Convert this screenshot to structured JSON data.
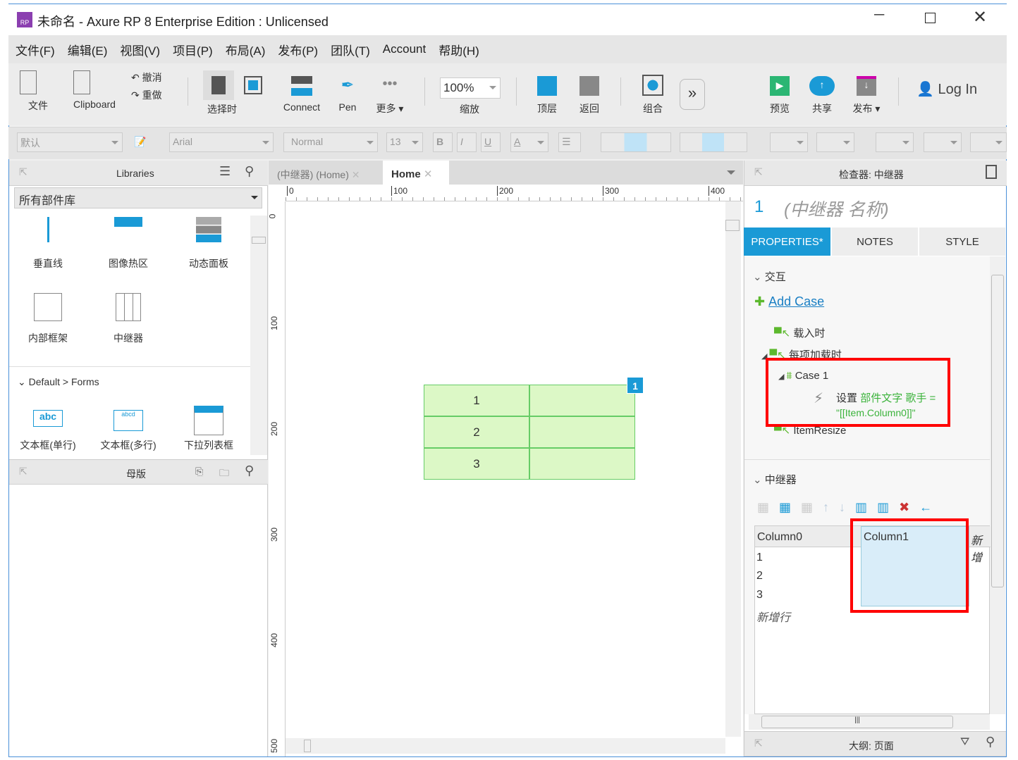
{
  "title": "未命名 - Axure RP 8 Enterprise Edition : Unlicensed",
  "app_icon": "RP",
  "menu": [
    "文件(F)",
    "编辑(E)",
    "视图(V)",
    "项目(P)",
    "布局(A)",
    "发布(P)",
    "团队(T)",
    "Account",
    "帮助(H)"
  ],
  "toolbar": {
    "file": "文件",
    "clipboard": "Clipboard",
    "undo": "撤消",
    "redo": "重做",
    "select": "选择时",
    "connect": "Connect",
    "pen": "Pen",
    "more": "更多 ▾",
    "zoom_value": "100%",
    "zoom": "缩放",
    "top": "顶层",
    "back": "返回",
    "group": "组合",
    "preview": "预览",
    "share": "共享",
    "publish": "发布 ▾",
    "login": "Log In"
  },
  "format": {
    "style": "默认",
    "font": "Arial",
    "weight": "Normal",
    "size": "13",
    "bold": "B",
    "italic": "I",
    "underline": "U",
    "font_color": "A"
  },
  "libraries": {
    "title": "Libraries",
    "selected": "所有部件库",
    "items": [
      {
        "label": "垂直线"
      },
      {
        "label": "图像热区"
      },
      {
        "label": "动态面板"
      },
      {
        "label": "内部框架"
      },
      {
        "label": "中继器"
      }
    ],
    "section": "Default > Forms",
    "forms": [
      {
        "label": "文本框(单行)",
        "icon_text": "abc"
      },
      {
        "label": "文本框(多行)",
        "icon_text": "abcd"
      },
      {
        "label": "下拉列表框"
      }
    ]
  },
  "masters": {
    "title": "母版"
  },
  "canvas": {
    "tabs": [
      {
        "label": "(中继器) (Home)"
      },
      {
        "label": "Home"
      }
    ],
    "ruler_h": [
      "0",
      "100",
      "200",
      "300",
      "400"
    ],
    "ruler_v": [
      "0",
      "100",
      "200",
      "300",
      "400",
      "500"
    ],
    "repeater_rows": [
      "1",
      "2",
      "3"
    ],
    "badge": "1"
  },
  "inspector": {
    "title": "检查器: 中继器",
    "id": "1",
    "name": "(中继器 名称)",
    "tabs": [
      "PROPERTIES*",
      "NOTES",
      "STYLE"
    ],
    "interactions": "交互",
    "add_case": "Add Case",
    "events": [
      "载入时",
      "每项加载时",
      "ItemResize"
    ],
    "case": "Case 1",
    "action_prefix": "设置",
    "action_target": "部件文字 歌手 =",
    "action_value": "\"[[Item.Column0]]\"",
    "repeater_section": "中继器",
    "columns": [
      "Column0",
      "Column1",
      "新增"
    ],
    "rows": [
      "1",
      "2",
      "3"
    ],
    "new_row": "新增行",
    "footer": "大纲: 页面"
  },
  "colors": {
    "accent": "#1a9ad6",
    "highlight": "#ff0000",
    "repeater_fill": "#dcf8c6",
    "link": "#1a7fc4"
  }
}
